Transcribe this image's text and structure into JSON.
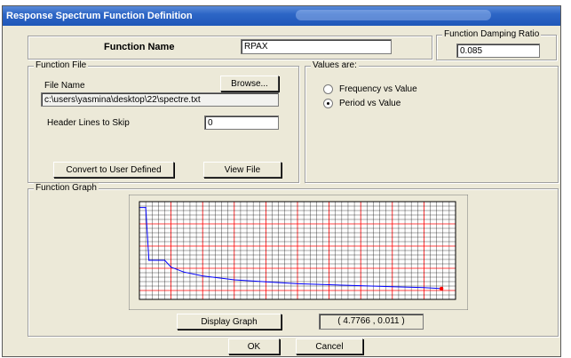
{
  "window": {
    "title": "Response Spectrum  Function Definition"
  },
  "function_name": {
    "label": "Function Name",
    "value": "RPAX"
  },
  "damping": {
    "legend": "Function Damping Ratio",
    "value": "0.085"
  },
  "function_file": {
    "legend": "Function File",
    "file_name_label": "File Name",
    "browse_label": "Browse...",
    "path": "c:\\users\\yasmina\\desktop\\22\\spectre.txt",
    "header_lines_label": "Header Lines to Skip",
    "header_lines_value": "0",
    "convert_label": "Convert to User Defined",
    "view_file_label": "View File"
  },
  "values_are": {
    "legend": "Values are:",
    "options": [
      {
        "label": "Frequency vs Value",
        "selected": false
      },
      {
        "label": "Period vs Value",
        "selected": true
      }
    ]
  },
  "graph": {
    "legend": "Function Graph",
    "display_label": "Display Graph",
    "coordinate_readout": "( 4.7766  ,  0.011 )",
    "line_color": "#0000ff",
    "marker_color": "#ff0000",
    "grid_color_major": "#ff0000",
    "grid_color_minor": "#000000"
  },
  "buttons": {
    "ok": "OK",
    "cancel": "Cancel"
  },
  "chart_data": {
    "type": "line",
    "title": "",
    "xlabel": "",
    "ylabel": "",
    "grid": true,
    "series": [
      {
        "x": [
          0.0,
          0.1,
          0.15,
          0.4,
          0.5,
          0.7,
          1.0,
          1.5,
          2.0,
          2.5,
          3.0,
          3.5,
          4.0,
          4.5,
          4.7766
        ],
        "values": [
          0.094,
          0.094,
          0.04,
          0.04,
          0.033,
          0.028,
          0.024,
          0.02,
          0.018,
          0.016,
          0.015,
          0.014,
          0.013,
          0.012,
          0.011
        ]
      }
    ],
    "highlight_point": {
      "x": 4.7766,
      "y": 0.011
    },
    "xlim": [
      0,
      5.0
    ],
    "ylim": [
      0,
      0.1
    ]
  }
}
